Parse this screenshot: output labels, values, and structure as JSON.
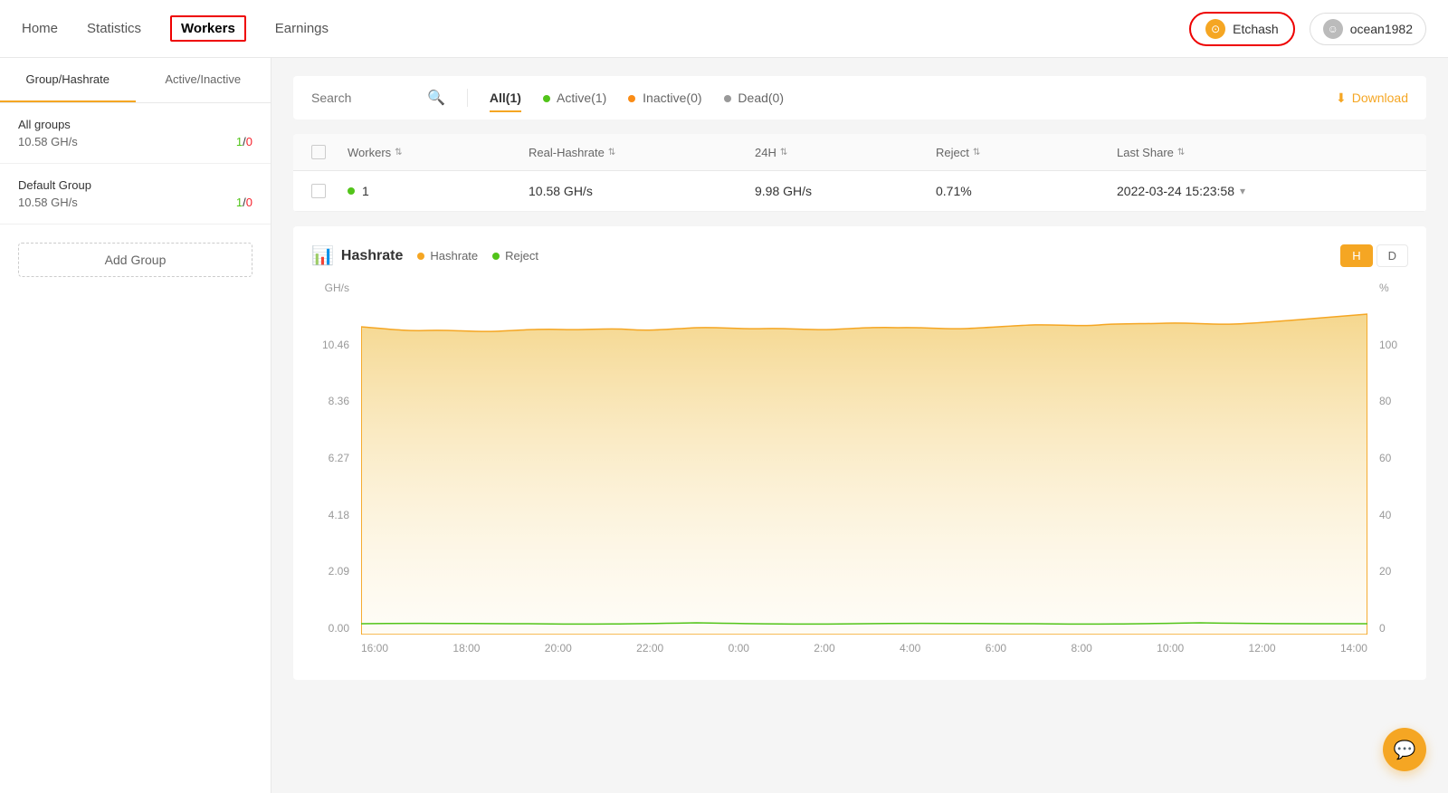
{
  "nav": {
    "links": [
      {
        "label": "Home",
        "id": "home",
        "active": false
      },
      {
        "label": "Statistics",
        "id": "statistics",
        "active": false
      },
      {
        "label": "Workers",
        "id": "workers",
        "active": true
      },
      {
        "label": "Earnings",
        "id": "earnings",
        "active": false
      }
    ],
    "etchash_label": "Etchash",
    "user_label": "ocean1982"
  },
  "sidebar": {
    "tabs": [
      {
        "label": "Group/Hashrate",
        "active": true
      },
      {
        "label": "Active/Inactive",
        "active": false
      }
    ],
    "groups": [
      {
        "name": "All groups",
        "hashrate": "10.58 GH/s",
        "active": "1",
        "inactive": "0"
      },
      {
        "name": "Default Group",
        "hashrate": "10.58 GH/s",
        "active": "1",
        "inactive": "0"
      }
    ],
    "add_group_label": "Add Group"
  },
  "filters": {
    "search_placeholder": "Search",
    "tabs": [
      {
        "label": "All(1)",
        "active": true
      },
      {
        "label": "Active(1)",
        "dot": "green"
      },
      {
        "label": "Inactive(0)",
        "dot": "orange"
      },
      {
        "label": "Dead(0)",
        "dot": "gray"
      }
    ],
    "download_label": "Download"
  },
  "table": {
    "headers": [
      {
        "label": "Workers",
        "sortable": true
      },
      {
        "label": "Real-Hashrate",
        "sortable": true
      },
      {
        "label": "24H",
        "sortable": true
      },
      {
        "label": "Reject",
        "sortable": true
      },
      {
        "label": "Last Share",
        "sortable": true
      }
    ],
    "rows": [
      {
        "name": "1",
        "status": "active",
        "real_hashrate": "10.58 GH/s",
        "h24": "9.98 GH/s",
        "reject": "0.71%",
        "last_share": "2022-03-24 15:23:58"
      }
    ]
  },
  "chart": {
    "title": "Hashrate",
    "legend": [
      {
        "label": "Hashrate",
        "color": "yellow"
      },
      {
        "label": "Reject",
        "color": "green"
      }
    ],
    "toggle_h": "H",
    "toggle_d": "D",
    "y_left_labels": [
      "10.46",
      "8.36",
      "6.27",
      "4.18",
      "2.09",
      "0.00"
    ],
    "y_right_labels": [
      "100",
      "80",
      "60",
      "40",
      "20",
      "0"
    ],
    "y_left_unit": "GH/s",
    "y_right_unit": "%",
    "x_labels": [
      "16:00",
      "18:00",
      "20:00",
      "22:00",
      "0:00",
      "2:00",
      "4:00",
      "6:00",
      "8:00",
      "10:00",
      "12:00",
      "14:00"
    ]
  }
}
